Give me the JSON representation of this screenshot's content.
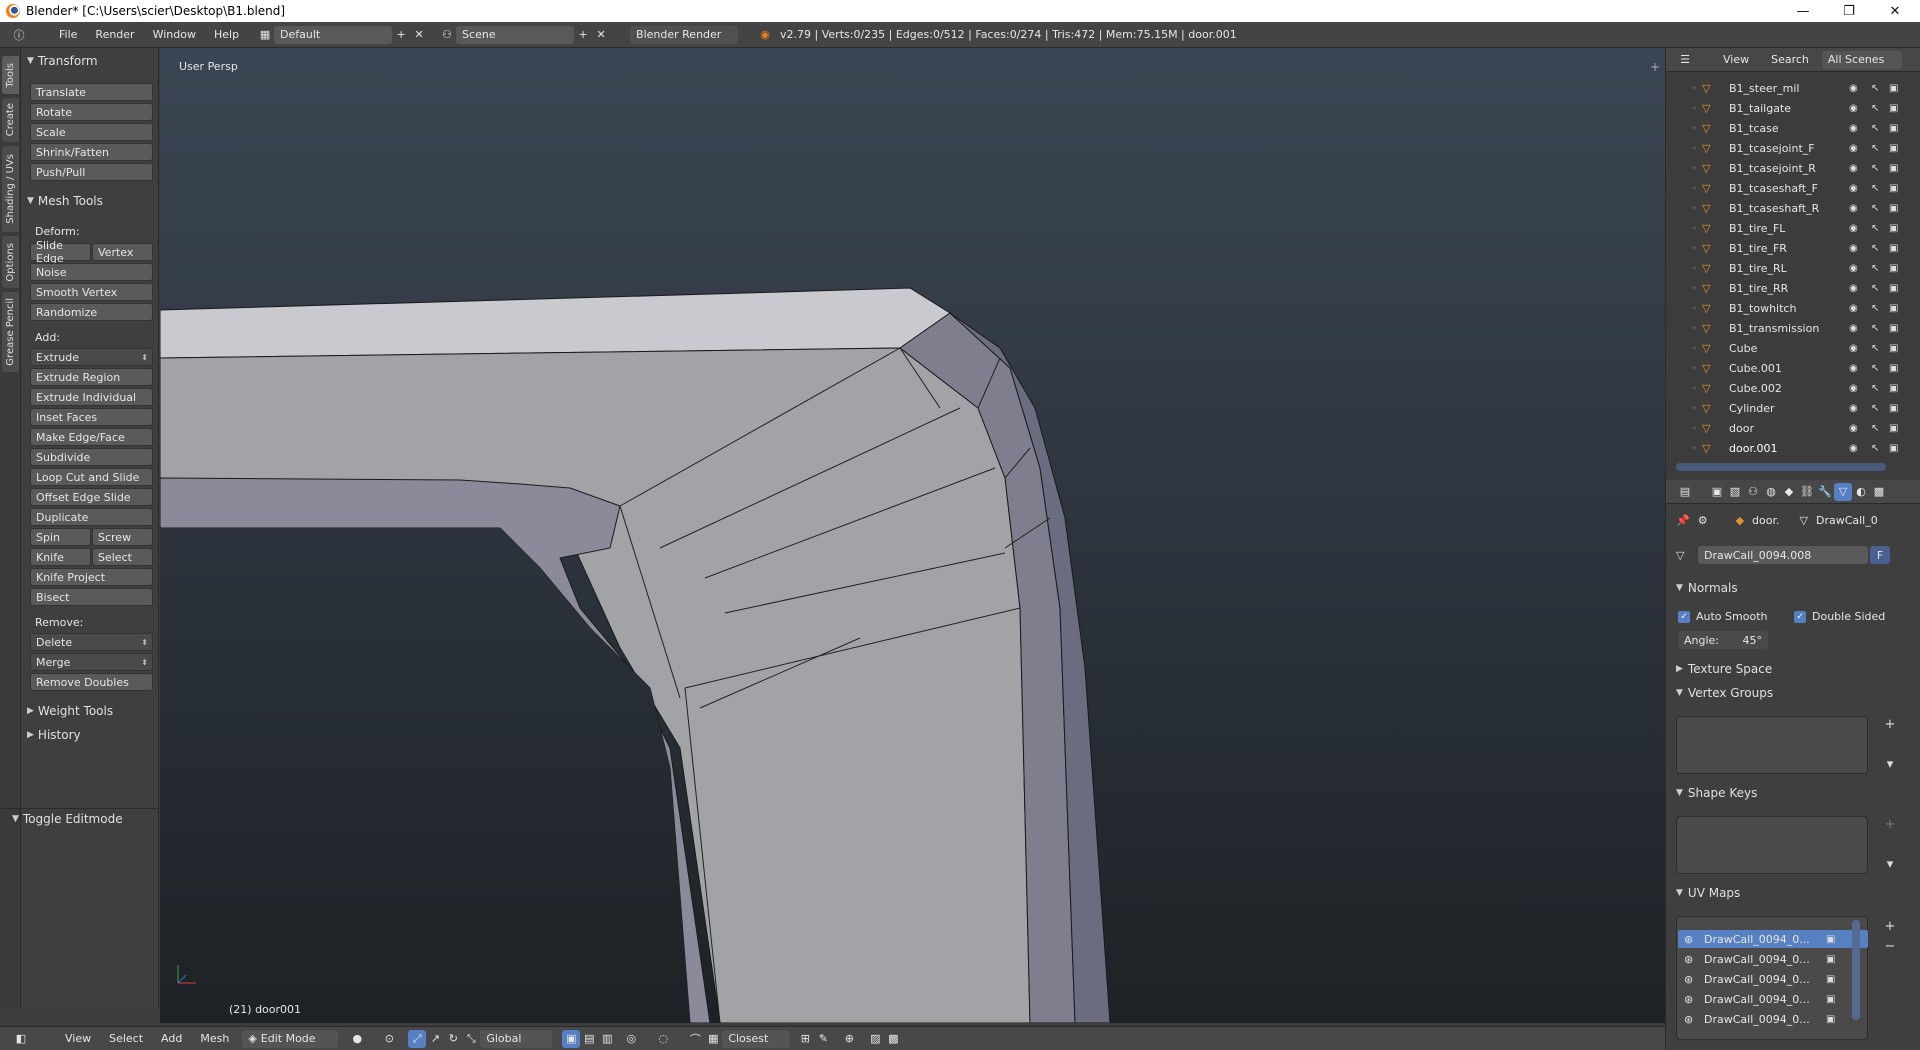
{
  "window": {
    "title": "Blender* [C:\\Users\\scier\\Desktop\\B1.blend]",
    "minimize": "—",
    "maximize": "❐",
    "close": "✕"
  },
  "infobar": {
    "menus": [
      "File",
      "Render",
      "Window",
      "Help"
    ],
    "layout": "Default",
    "scene": "Scene",
    "engine": "Blender Render",
    "stats": "v2.79 | Verts:0/235 | Edges:0/512 | Faces:0/274 | Tris:472 | Mem:75.15M | door.001"
  },
  "tabs": [
    "Tools",
    "Create",
    "Shading / UVs",
    "Options",
    "Grease Pencil"
  ],
  "toolshelf": {
    "transform_header": "Transform",
    "transform": [
      "Translate",
      "Rotate",
      "Scale",
      "Shrink/Fatten",
      "Push/Pull"
    ],
    "mesh_tools_header": "Mesh Tools",
    "deform_label": "Deform:",
    "slide_edge": "Slide Edge",
    "vertex": "Vertex",
    "deform": [
      "Noise",
      "Smooth Vertex",
      "Randomize"
    ],
    "add_label": "Add:",
    "add": [
      "Extrude",
      "Extrude Region",
      "Extrude Individual",
      "Inset Faces",
      "Make Edge/Face",
      "Subdivide",
      "Loop Cut and Slide",
      "Offset Edge Slide",
      "Duplicate"
    ],
    "spin": "Spin",
    "screw": "Screw",
    "knife": "Knife",
    "select": "Select",
    "knife_project": "Knife Project",
    "bisect": "Bisect",
    "remove_label": "Remove:",
    "remove": [
      "Delete",
      "Merge",
      "Remove Doubles"
    ],
    "weight_tools": "Weight Tools",
    "history": "History",
    "toggle_editmode": "Toggle Editmode"
  },
  "viewport": {
    "persp_label": "User Persp",
    "object_label": "(21) door001"
  },
  "bottombar": {
    "menus": [
      "View",
      "Select",
      "Add",
      "Mesh"
    ],
    "mode": "Edit Mode",
    "orientation": "Global",
    "snap": "Closest"
  },
  "outliner": {
    "header": {
      "view": "View",
      "search": "Search",
      "scenes": "All Scenes"
    },
    "items": [
      "B1_steer_mil",
      "B1_tailgate",
      "B1_tcase",
      "B1_tcasejoint_F",
      "B1_tcasejoint_R",
      "B1_tcaseshaft_F",
      "B1_tcaseshaft_R",
      "B1_tire_FL",
      "B1_tire_FR",
      "B1_tire_RL",
      "B1_tire_RR",
      "B1_towhitch",
      "B1_transmission",
      "Cube",
      "Cube.001",
      "Cube.002",
      "Cylinder",
      "door",
      "door.001"
    ]
  },
  "properties": {
    "breadcrumb_object": "door.",
    "breadcrumb_mesh": "DrawCall_0",
    "mesh_name": "DrawCall_0094.008",
    "fake_user": "F",
    "normals_header": "Normals",
    "auto_smooth": "Auto Smooth",
    "double_sided": "Double Sided",
    "angle_label": "Angle:",
    "angle_value": "45°",
    "texture_space": "Texture Space",
    "vertex_groups": "Vertex Groups",
    "shape_keys": "Shape Keys",
    "uv_maps": "UV Maps",
    "uv_items": [
      "DrawCall_0094_0...",
      "DrawCall_0094_0...",
      "DrawCall_0094_0...",
      "DrawCall_0094_0...",
      "DrawCall_0094_0..."
    ]
  }
}
